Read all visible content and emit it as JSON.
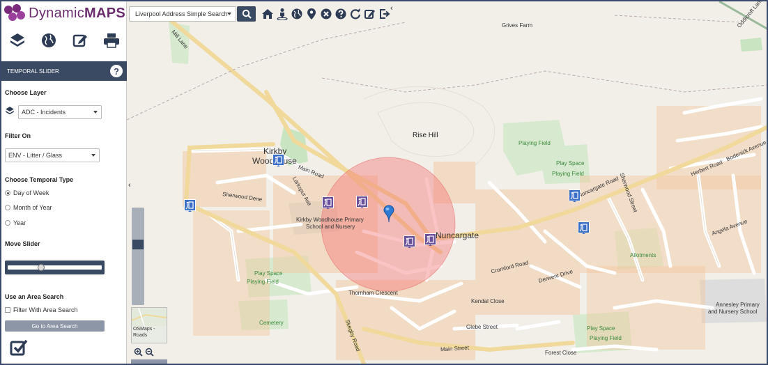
{
  "app": {
    "logo_text_light": "Dynamic",
    "logo_text_bold": "MAPS",
    "brand_color": "#6b2c6e",
    "panel_color": "#3a4a63"
  },
  "toolbar": {
    "search_select": "Liverpool Address Simple Search",
    "search_icon": "search-icon",
    "icons": [
      "home-icon",
      "person-icon",
      "globe-icon",
      "location-pin-icon",
      "clear-icon",
      "help-icon",
      "refresh-icon",
      "edit-icon",
      "logout-icon"
    ]
  },
  "sidebar": {
    "tools": [
      "layers-icon",
      "globe-icon",
      "edit-icon",
      "print-icon"
    ],
    "panel_title": "TEMPORAL SLIDER",
    "choose_layer_label": "Choose Layer",
    "layer_value": "ADC - Incidents",
    "filter_label": "Filter On",
    "filter_value": "ENV - Litter / Glass",
    "temporal_type_label": "Choose Temporal Type",
    "temporal_options": [
      "Day of Week",
      "Month of Year",
      "Year"
    ],
    "temporal_selected": "Day of Week",
    "move_slider_label": "Move Slider",
    "area_search_label": "Use an Area Search",
    "filter_area_label": "Filter With Area Search",
    "area_button": "Go to Area Search"
  },
  "map": {
    "basemap_label_1": "OSMaps -",
    "basemap_label_2": "Roads",
    "labels": {
      "kirkby_1": "Kirkby",
      "kirkby_2": "Woodhouse",
      "nuncargate": "Nuncargate",
      "rise_hill": "Rise Hill",
      "grives_farm": "Grives Farm",
      "school_1": "Kirkby Woodhouse Primary",
      "school_2": "School and Nursery",
      "annesley_1": "Annesley Primary",
      "annesley_2": "and Nursery School",
      "playing_field_1": "Playing Field",
      "play_space_1": "Play Space",
      "playing_field_2": "Playing Field",
      "play_space_2": "Play Space",
      "playing_field_3": "Playing Field",
      "play_space_3": "Play Space",
      "playing_field_4": "Playing Field",
      "allotments": "Allotments",
      "cemetery": "Cemetery",
      "main_road": "Main Road",
      "main_road_2": "Main Street",
      "thornham": "Thornham Crescent",
      "glebe": "Glebe Street",
      "kendal": "Kendal Close",
      "sherwood": "Sherwood Dene",
      "derwent": "Derwent Drive",
      "cromford": "Cromford Road",
      "forest_close": "Forest Close",
      "larkspur": "Larkspur Ave",
      "skegby": "Skegby Road",
      "nuncargate_road": "Nuncargate Road",
      "mill_lane": "Mill Lane",
      "herbert": "Herbert Road",
      "oddicroft": "Oddicroft Lane",
      "bodenick": "Bodenick Avenue",
      "sherwood_street": "Sherwood Street",
      "angela": "Angela Avenue"
    }
  }
}
